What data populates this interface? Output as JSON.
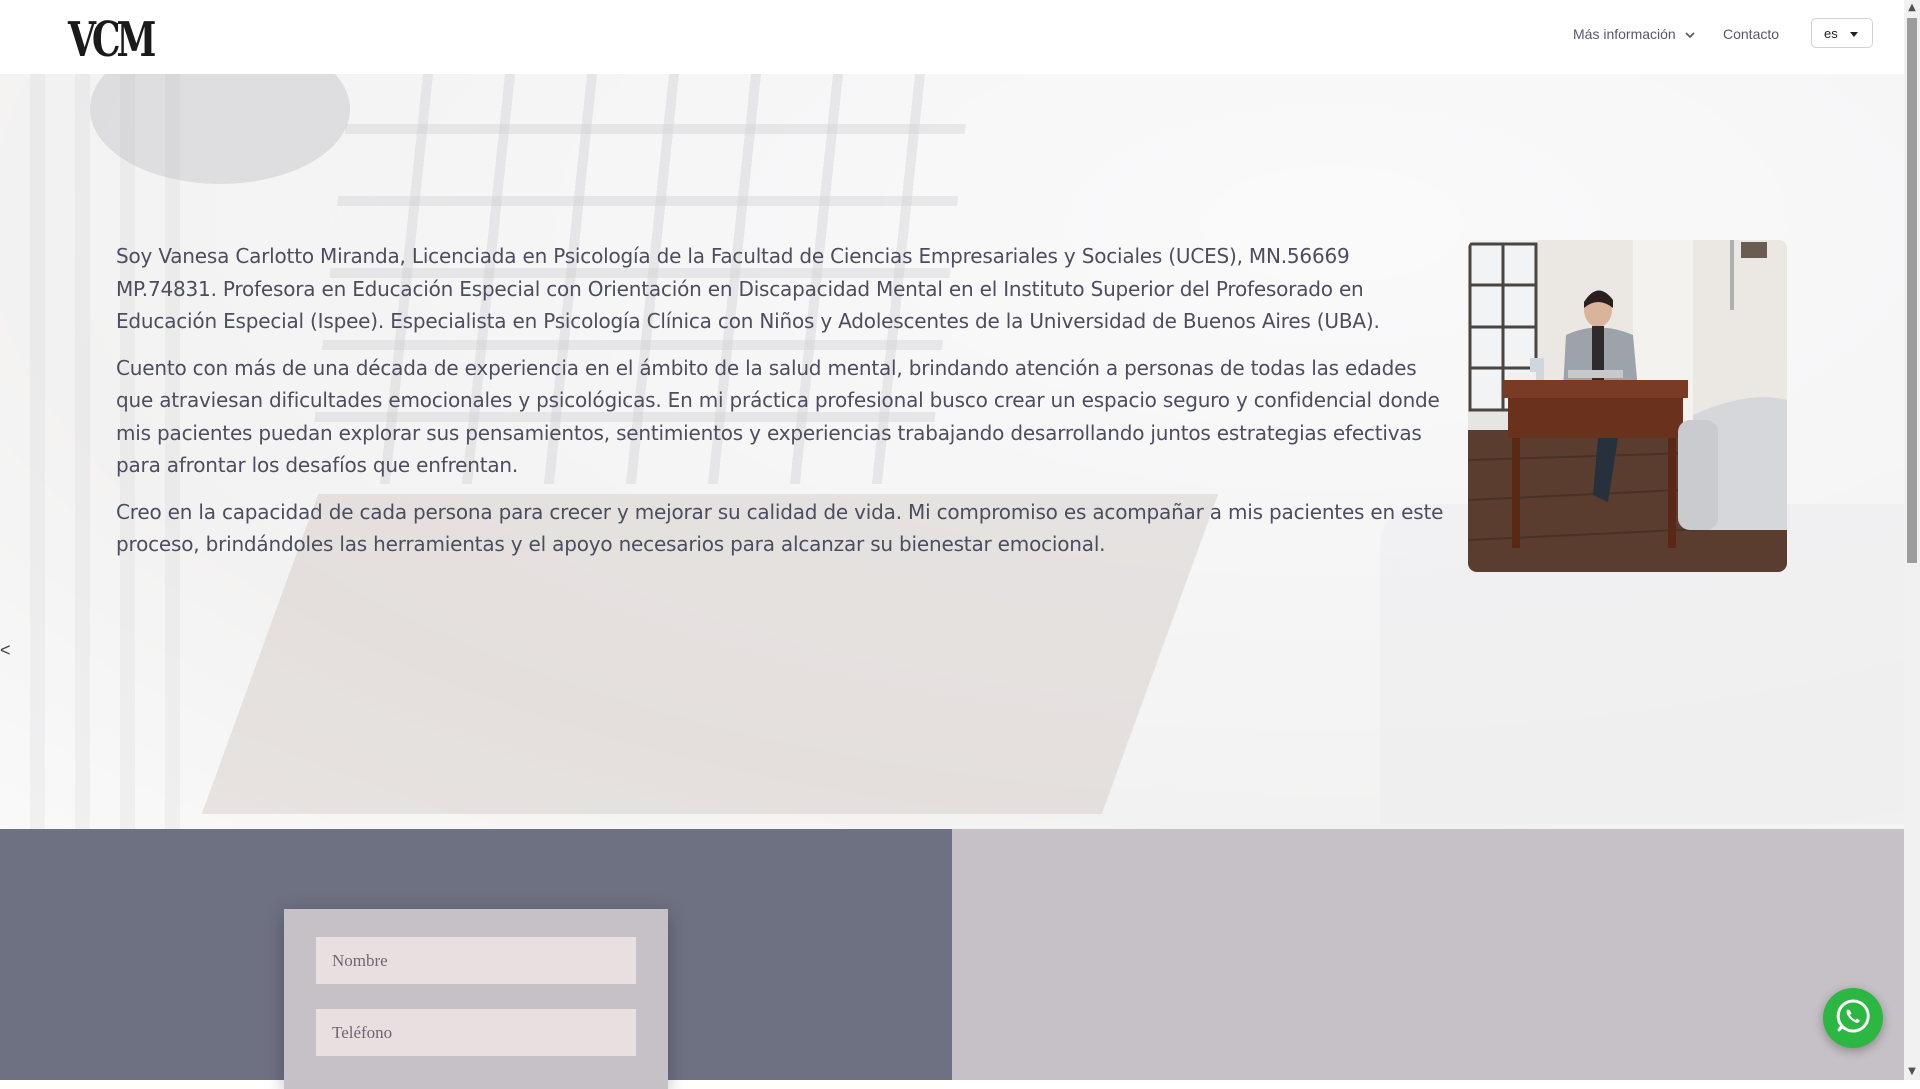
{
  "header": {
    "logo_text": "VCM",
    "nav": {
      "more_info_label": "Más información",
      "contact_label": "Contacto"
    },
    "language": {
      "selected": "es"
    }
  },
  "hero": {
    "paragraphs": [
      "Soy Vanesa Carlotto Miranda, Licenciada en Psicología de la Facultad de Ciencias Empresariales y Sociales (UCES), MN.56669 MP.74831. Profesora en Educación Especial con Orientación en Discapacidad Mental en el Instituto Superior del Profesorado en Educación Especial (Ispee). Especialista en Psicología Clínica con Niños y Adolescentes de la Universidad de Buenos Aires (UBA).",
      "Cuento con más de una década de experiencia en el ámbito de la salud mental, brindando atención a personas de todas las edades que atraviesan dificultades emocionales y psicológicas. En mi práctica profesional busco crear un espacio seguro y confidencial donde mis pacientes puedan explorar sus pensamientos, sentimientos y experiencias trabajando desarrollando juntos estrategias efectivas para afrontar los desafíos que enfrentan.",
      "Creo en la capacidad de cada persona para crecer y mejorar su calidad de vida. Mi compromiso es acompañar a mis pacientes en este proceso, brindándoles las herramientas y el apoyo necesarios para alcanzar su bienestar emocional."
    ],
    "prev_arrow": "<"
  },
  "contact_form": {
    "name_placeholder": "Nombre",
    "phone_placeholder": "Teléfono"
  },
  "colors": {
    "contact_left_bg": "#6e7182",
    "contact_right_bg": "#c5c1c6",
    "whatsapp_green": "#2bb741",
    "body_text": "#4b4e5e"
  },
  "icons": {
    "nav_more": "chevron-down-icon",
    "language": "caret-down-icon",
    "whatsapp": "whatsapp-icon"
  }
}
